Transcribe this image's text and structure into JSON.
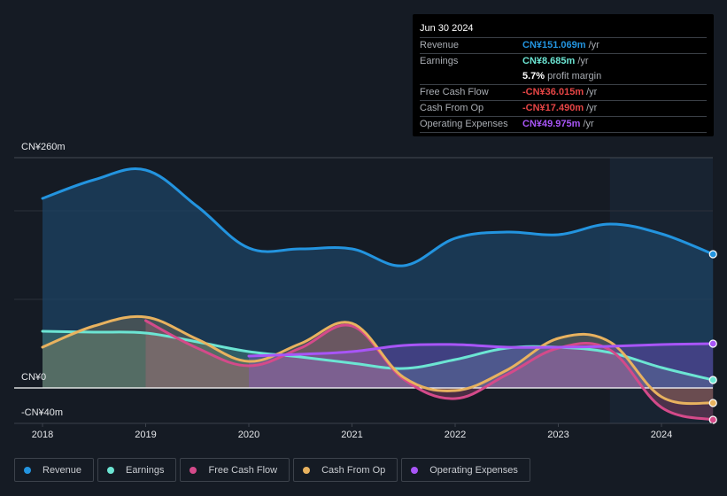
{
  "tooltip": {
    "date": "Jun 30 2024",
    "rows": [
      {
        "label": "Revenue",
        "value": "CN¥151.069m",
        "unit": "/yr",
        "color": "#2394df"
      },
      {
        "label": "Earnings",
        "value": "CN¥8.685m",
        "unit": "/yr",
        "color": "#6ce5d3"
      },
      {
        "label": "",
        "value": "5.7%",
        "unit": "profit margin",
        "color": "#ffffff"
      },
      {
        "label": "Free Cash Flow",
        "value": "-CN¥36.015m",
        "unit": "/yr",
        "color": "#e64545"
      },
      {
        "label": "Cash From Op",
        "value": "-CN¥17.490m",
        "unit": "/yr",
        "color": "#e64545"
      },
      {
        "label": "Operating Expenses",
        "value": "CN¥49.975m",
        "unit": "/yr",
        "color": "#a855f7"
      }
    ]
  },
  "chart_data": {
    "type": "area",
    "title": "",
    "xlabel": "",
    "ylabel": "",
    "y_tick_labels": {
      "top": "CN¥260m",
      "zero": "CN¥0",
      "bottom": "-CN¥40m"
    },
    "ylim": [
      -40,
      260
    ],
    "xlim": [
      2017.75,
      2024.5
    ],
    "x_ticks": [
      "2018",
      "2019",
      "2020",
      "2021",
      "2022",
      "2023",
      "2024"
    ],
    "highlight_start": 2023.5,
    "grid": true,
    "legend_position": "bottom-left",
    "series": [
      {
        "name": "Revenue",
        "color": "#2394df",
        "x": [
          2018,
          2018.5,
          2019,
          2019.5,
          2020,
          2020.5,
          2021,
          2021.5,
          2022,
          2022.5,
          2023,
          2023.5,
          2024,
          2024.5
        ],
        "values": [
          214,
          235,
          246,
          205,
          158,
          157,
          157,
          138,
          169,
          176,
          173,
          185,
          174,
          151
        ]
      },
      {
        "name": "Earnings",
        "color": "#6ce5d3",
        "x": [
          2018,
          2018.5,
          2019,
          2019.5,
          2020,
          2020.5,
          2021,
          2021.5,
          2022,
          2022.5,
          2023,
          2023.5,
          2024,
          2024.5
        ],
        "values": [
          64,
          63,
          62,
          52,
          41,
          35,
          28,
          22,
          32,
          45,
          46,
          40,
          23,
          9
        ]
      },
      {
        "name": "Free Cash Flow",
        "color": "#d44a8a",
        "x": [
          2019,
          2019.5,
          2020,
          2020.5,
          2021,
          2021.5,
          2022,
          2022.5,
          2023,
          2023.5,
          2024,
          2024.5
        ],
        "values": [
          76,
          45,
          25,
          45,
          70,
          10,
          -12,
          15,
          45,
          43,
          -22,
          -36
        ]
      },
      {
        "name": "Cash From Op",
        "color": "#e8b25f",
        "x": [
          2018,
          2018.5,
          2019,
          2019.5,
          2020,
          2020.5,
          2021,
          2021.5,
          2022,
          2022.5,
          2023,
          2023.5,
          2024,
          2024.5
        ],
        "values": [
          46,
          70,
          80,
          55,
          30,
          50,
          73,
          12,
          -3,
          20,
          56,
          52,
          -10,
          -17
        ]
      },
      {
        "name": "Operating Expenses",
        "color": "#a855f7",
        "x": [
          2020,
          2020.5,
          2021,
          2021.5,
          2022,
          2022.5,
          2023,
          2023.5,
          2024,
          2024.5
        ],
        "values": [
          36,
          38,
          41,
          48,
          49,
          46,
          46,
          47,
          49,
          50
        ]
      }
    ]
  },
  "legend": [
    {
      "label": "Revenue",
      "color": "#2394df"
    },
    {
      "label": "Earnings",
      "color": "#6ce5d3"
    },
    {
      "label": "Free Cash Flow",
      "color": "#d44a8a"
    },
    {
      "label": "Cash From Op",
      "color": "#e8b25f"
    },
    {
      "label": "Operating Expenses",
      "color": "#a855f7"
    }
  ]
}
